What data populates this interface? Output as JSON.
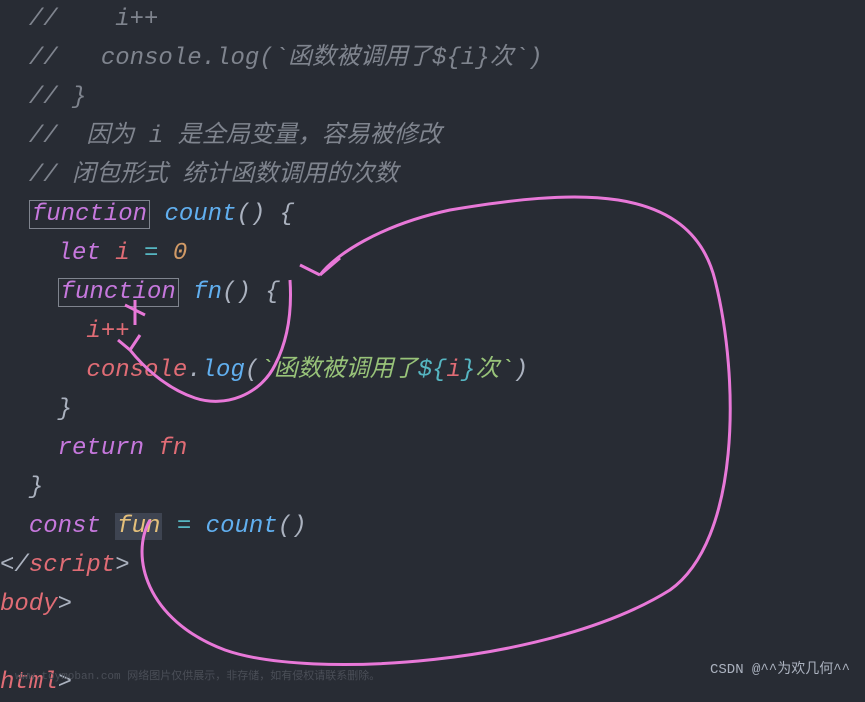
{
  "code": {
    "line1_comment": "//    i++",
    "line2_comment": "//   console.log(`函数被调用了${i}次`)",
    "line3_comment": "// }",
    "line4_comment": "//  因为 i 是全局变量，容易被修改",
    "line5_comment": "// 闭包形式 统计函数调用的次数",
    "kw_function": "function",
    "fn_count": "count",
    "parens": "()",
    "brace_open": " {",
    "kw_let": "let",
    "var_i": "i",
    "eq": " = ",
    "num_zero": "0",
    "fn_fn": "fn",
    "inc": "i++",
    "console": "console",
    "dot": ".",
    "log": "log",
    "paren_open": "(",
    "paren_close": ")",
    "backtick": "`",
    "str_part1": "函数被调用了",
    "dollar_open": "${",
    "template_i": "i",
    "dollar_close": "}",
    "str_part2": "次",
    "brace_close": "}",
    "kw_return": "return",
    "kw_const": "const",
    "const_fun": "fun",
    "tag_script_close": "script",
    "tag_body": "body",
    "tag_html": "html",
    "gt": ">",
    "lt_slash": "</"
  },
  "watermark": "CSDN @^^为欢几何^^",
  "footer_text": "www.toymoban.com 网络图片仅供展示，非存储，如有侵权请联系删除。"
}
